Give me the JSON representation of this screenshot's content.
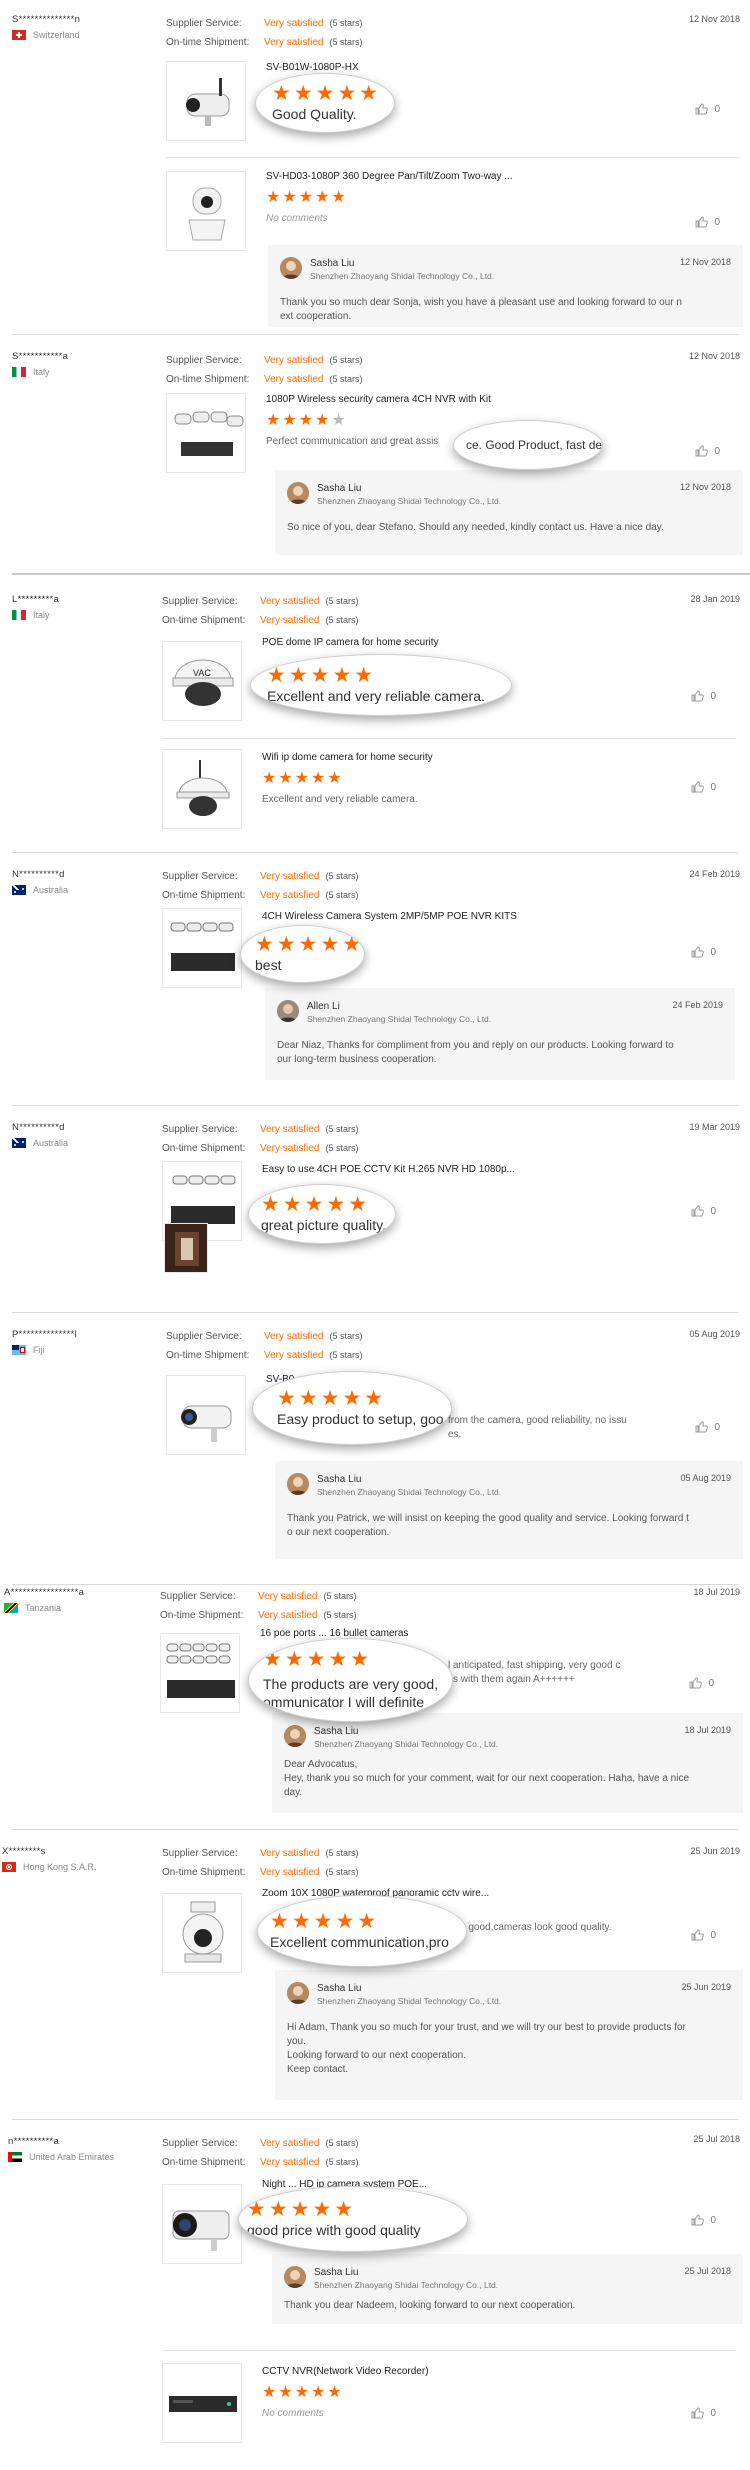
{
  "labels": {
    "supplier_service": "Supplier Service:",
    "ontime_shipment": "On-time Shipment:",
    "stars_suffix": "(5 stars)",
    "company": "Shenzhen Zhaoyang Shidai Technology Co., Ltd.",
    "no_comments": "No comments"
  },
  "reviews": [
    {
      "buyer": "S**************n",
      "country": "Switzerland",
      "date": "12 Nov 2018",
      "supplier_rating": "Very satisfied",
      "shipment_rating": "Very satisfied",
      "products": [
        {
          "title": "SV-B01W-1080P-HX",
          "comment": "Good Quality.",
          "stars": 5,
          "likes": "0",
          "bubble_text": "Good Quality."
        },
        {
          "title": "SV-HD03-1080P 360 Degree Pan/Tilt/Zoom Two-way ...",
          "comment": "No comments",
          "stars": 5,
          "likes": "0"
        }
      ],
      "reply": {
        "name": "Sasha Liu",
        "date": "12 Nov 2018",
        "text": "Thank you so much dear Sonja,  wish you have a pleasant use and looking forward to our n\next cooperation."
      }
    },
    {
      "buyer": "S***********a",
      "country": "Italy",
      "date": "12 Nov 2018",
      "supplier_rating": "Very satisfied",
      "shipment_rating": "Very satisfied",
      "products": [
        {
          "title": "1080P Wireless security camera 4CH NVR with Kit",
          "comment": "Perfect communication and great assis",
          "stars": 4,
          "likes": "0",
          "bubble_text": "ce. Good Product, fast delivery."
        }
      ],
      "reply": {
        "name": "Sasha Liu",
        "date": "12 Nov 2018",
        "text": "So nice of you, dear Stefano. Should any needed, kindly contact us. Have a nice day."
      }
    },
    {
      "buyer": "L*********a",
      "country": "Italy",
      "date": "28 Jan 2019",
      "supplier_rating": "Very satisfied",
      "shipment_rating": "Very satisfied",
      "products": [
        {
          "title": "POE dome IP camera for home security",
          "comment": "Excellent and very reliable camera.",
          "stars": 5,
          "likes": "0",
          "bubble_text": "Excellent and very reliable camera."
        },
        {
          "title": "Wifi ip dome camera for home security",
          "comment": "Excellent and very reliable camera.",
          "stars": 5,
          "likes": "0"
        }
      ]
    },
    {
      "buyer": "N**********d",
      "country": "Australia",
      "date": "24 Feb 2019",
      "supplier_rating": "Very satisfied",
      "shipment_rating": "Very satisfied",
      "products": [
        {
          "title": "4CH Wireless Camera System 2MP/5MP POE NVR KITS",
          "comment": "best",
          "stars": 5,
          "likes": "0",
          "bubble_text": "best"
        }
      ],
      "reply": {
        "name": "Allen Li",
        "date": "24 Feb 2019",
        "text": "Dear Niaz, Thanks for compliment from you and reply on our products.  Looking forward to\nour long-term business cooperation."
      }
    },
    {
      "buyer": "N**********d",
      "country": "Australia",
      "date": "19 Mar 2019",
      "supplier_rating": "Very satisfied",
      "shipment_rating": "Very satisfied",
      "products": [
        {
          "title": "Easy to use 4CH POE CCTV Kit H.265 NVR HD 1080p...",
          "comment": "great picture quality.",
          "stars": 5,
          "likes": "0",
          "bubble_text": "great picture quality."
        }
      ]
    },
    {
      "buyer": "P**************l",
      "country": "Fiji",
      "date": "05 Aug 2019",
      "supplier_rating": "Very satisfied",
      "shipment_rating": "Very satisfied",
      "products": [
        {
          "title": "SV-B0...",
          "comment": "from the camera, good reliability, no issu\nes.",
          "stars": 5,
          "likes": "0",
          "bubble_text": "Easy product to setup, goo"
        }
      ],
      "reply": {
        "name": "Sasha Liu",
        "date": "05 Aug 2019",
        "text": "Thank you Patrick, we will insist on keeping the good quality and service. Looking forward t\no our next cooperation."
      }
    },
    {
      "buyer": "A*****************a",
      "country": "Tanzania",
      "date": "18 Jul 2019",
      "supplier_rating": "Very satisfied",
      "shipment_rating": "Very satisfied",
      "products": [
        {
          "title": "16 poe ports ... 16 bullet cameras",
          "comment": "l anticipated, fast shipping, very good c\nss with them again A++++++",
          "stars": 5,
          "likes": "0",
          "bubble_text": "The products are very good,\nommunicator I will definite"
        }
      ],
      "reply": {
        "name": "Sasha Liu",
        "date": "18 Jul 2019",
        "text": "Dear Advocatus,\nHey, thank you so much for your comment, wait for our next cooperation. Haha, have a nice\nday."
      }
    },
    {
      "buyer": "X********s",
      "country": "Hong Kong S.A.R.",
      "date": "25 Jun 2019",
      "supplier_rating": "Very satisfied",
      "shipment_rating": "Very satisfied",
      "products": [
        {
          "title": "Zoom 10X 1080P waterproof panoramic cctv wire...",
          "comment": "e is good,cameras look good quality.",
          "stars": 5,
          "likes": "0",
          "bubble_text": "Excellent communication,pro"
        }
      ],
      "reply": {
        "name": "Sasha Liu",
        "date": "25 Jun 2019",
        "text": "Hi Adam, Thank you so much for your trust, and we will try our best to provide products for\nyou.\nLooking forward to our next cooperation.\nKeep contact."
      }
    },
    {
      "buyer": "n**********a",
      "country": "United Arab Emirates",
      "date": "25 Jul 2018",
      "supplier_rating": "Very satisfied",
      "shipment_rating": "Very satisfied",
      "products": [
        {
          "title": "Night ... HD ip camera system POE...",
          "comment": "good price with good quality",
          "stars": 5,
          "likes": "0",
          "bubble_text": "good price with good quality"
        },
        {
          "title": "CCTV NVR(Network Video Recorder)",
          "comment": "No comments",
          "stars": 5,
          "likes": "0"
        }
      ],
      "reply": {
        "name": "Sasha Liu",
        "date": "25 Jul 2018",
        "text": "Thank you dear Nadeem, looking forward to our next cooperation."
      }
    }
  ]
}
